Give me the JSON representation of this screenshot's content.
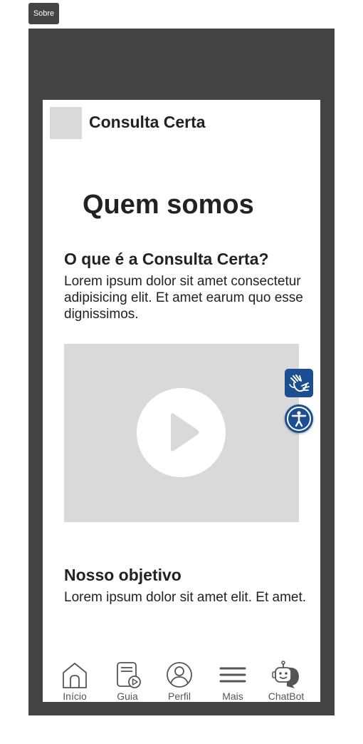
{
  "frame": {
    "tag_label": "Sobre"
  },
  "header": {
    "app_name": "Consulta Certa"
  },
  "page": {
    "title": "Quem somos"
  },
  "sections": [
    {
      "heading": "O que é a Consulta Certa?",
      "body": "Lorem ipsum dolor sit amet consectetur adipisicing elit. Et amet earum quo esse dignissimos."
    },
    {
      "heading": "Nosso objetivo",
      "body": "Lorem ipsum dolor sit amet elit. Et amet."
    }
  ],
  "video": {
    "icon": "play-icon"
  },
  "accessibility": {
    "libras_icon": "sign-language-icon",
    "access_icon": "accessibility-icon",
    "brand_color": "#1c4f91"
  },
  "tabbar": {
    "items": [
      {
        "label": "Início",
        "icon": "home-icon"
      },
      {
        "label": "Guia",
        "icon": "guide-icon"
      },
      {
        "label": "Perfil",
        "icon": "profile-icon"
      },
      {
        "label": "Mais",
        "icon": "menu-icon"
      },
      {
        "label": "ChatBot",
        "icon": "chatbot-icon"
      }
    ]
  },
  "colors": {
    "frame": "#444444",
    "placeholder": "#d9d9d9",
    "text": "#222222"
  }
}
